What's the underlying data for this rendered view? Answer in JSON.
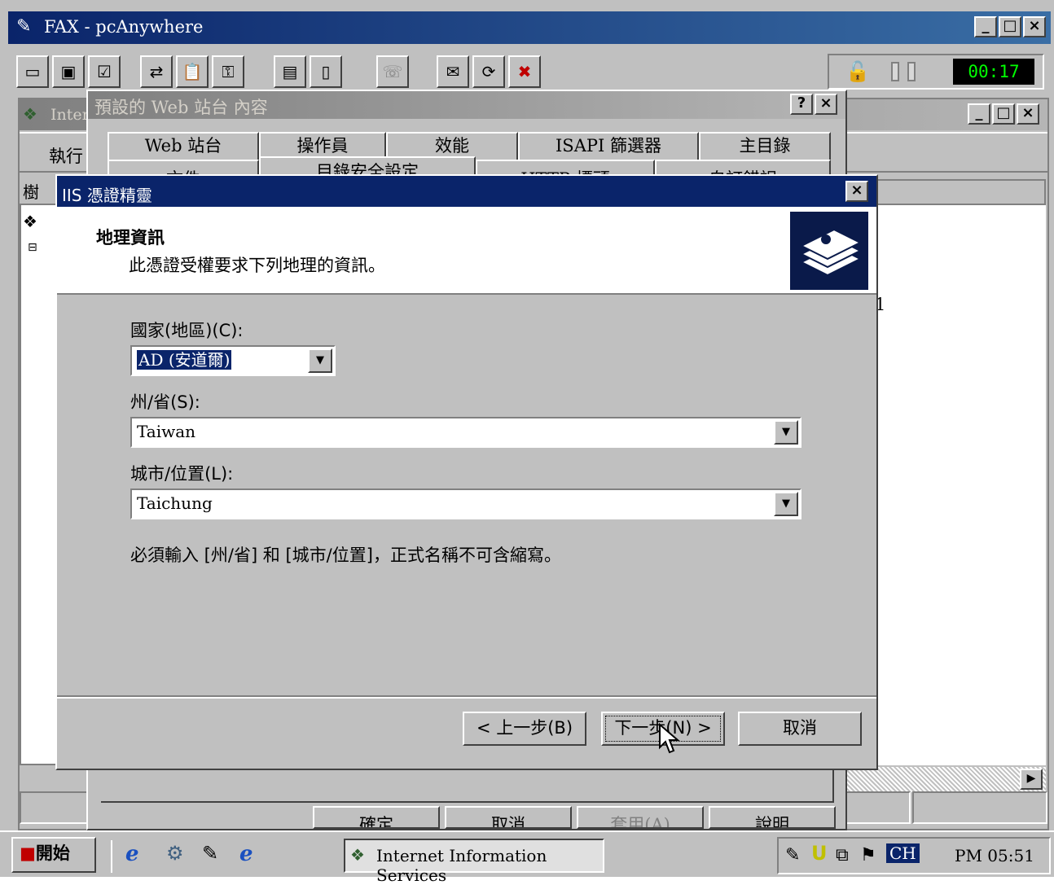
{
  "app": {
    "title": "FAX - pcAnywhere",
    "timer": "00:17"
  },
  "mmc": {
    "title_partial": "Inter",
    "action_menu": "執行",
    "tree_header": "樹",
    "list_fragment": "1"
  },
  "props": {
    "title": "預設的 Web 站台 內容",
    "help_btn": "?",
    "close_btn": "×",
    "tabs_row1": [
      "Web 站台",
      "操作員",
      "效能",
      "ISAPI 篩選器",
      "主目錄"
    ],
    "tabs_row2": [
      "文件",
      "目錄安全設定",
      "HTTP 標頭",
      "自訂錯誤"
    ],
    "buttons": [
      "確定",
      "取消",
      "套用(A)",
      "說明"
    ]
  },
  "wizard": {
    "title": "IIS 憑證精靈",
    "header_title": "地理資訊",
    "header_subtitle": "此憑證受權要求下列地理的資訊。",
    "country_label": "國家(地區)(C):",
    "country_value": "AD (安道爾)",
    "state_label": "州/省(S):",
    "state_value": "Taiwan",
    "city_label": "城市/位置(L):",
    "city_value": "Taichung",
    "note": "必須輸入 [州/省] 和 [城市/位置]，正式名稱不可含縮寫。",
    "back_button": "< 上一步(B)",
    "next_button": "下一步(N) >",
    "cancel_button": "取消"
  },
  "taskbar": {
    "start": "開始",
    "task": "Internet Information Services",
    "lang": "CH",
    "clock": "PM 05:51"
  },
  "colors": {
    "titlebar_active": "#0a246a",
    "face": "#c0c0c0",
    "timer_bg": "#000000",
    "timer_fg": "#00ff00"
  }
}
